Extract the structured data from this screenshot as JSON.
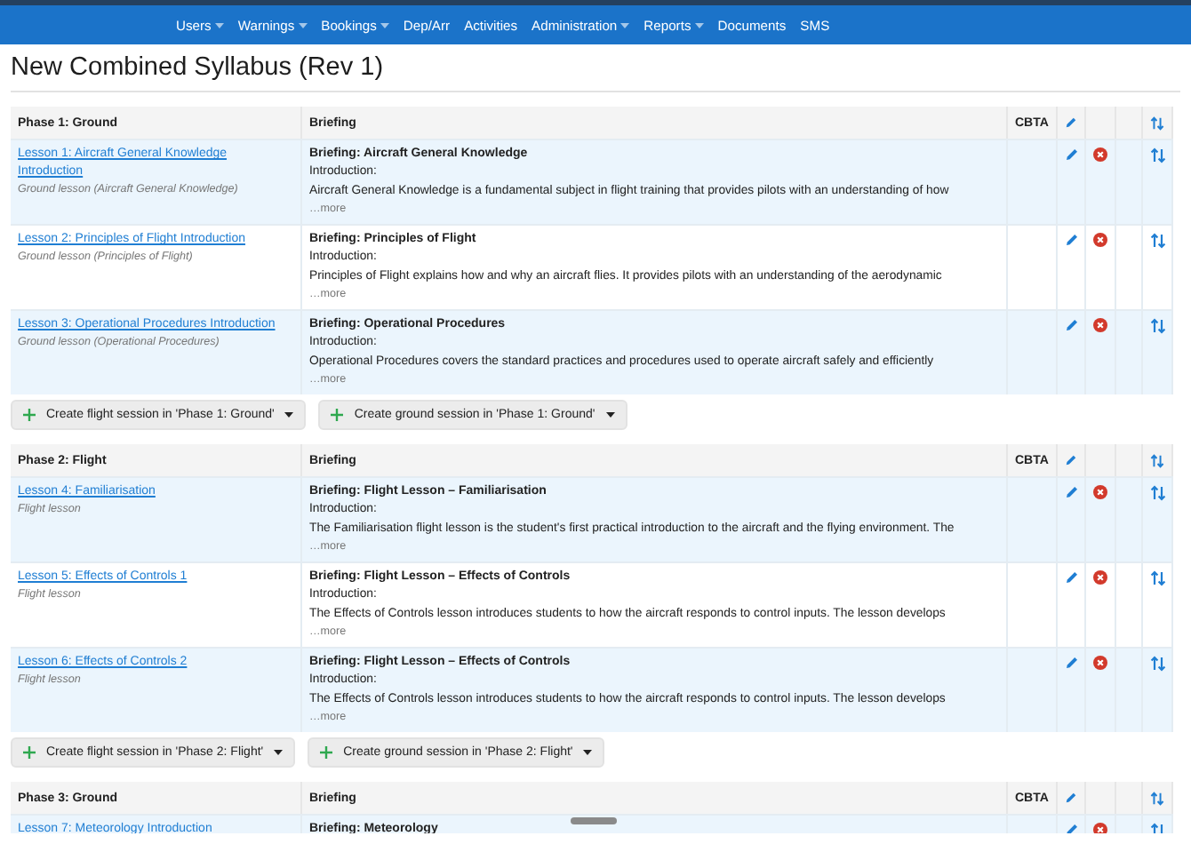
{
  "nav": [
    {
      "label": "Users",
      "dropdown": true
    },
    {
      "label": "Warnings",
      "dropdown": true
    },
    {
      "label": "Bookings",
      "dropdown": true
    },
    {
      "label": "Dep/Arr",
      "dropdown": false
    },
    {
      "label": "Activities",
      "dropdown": false
    },
    {
      "label": "Administration",
      "dropdown": true
    },
    {
      "label": "Reports",
      "dropdown": true
    },
    {
      "label": "Documents",
      "dropdown": false
    },
    {
      "label": "SMS",
      "dropdown": false
    }
  ],
  "title": "New Combined Syllabus (Rev 1)",
  "phases": [
    {
      "name": "Phase 1: Ground",
      "briefing_header": "Briefing",
      "cbta_header": "CBTA",
      "lessons": [
        {
          "title": "Lesson 1: Aircraft General Knowledge Introduction",
          "subtitle": "Ground lesson (Aircraft General Knowledge)",
          "briefing_title": "Briefing: Aircraft General Knowledge",
          "intro_label": "Introduction:",
          "text": "Aircraft General Knowledge is a fundamental subject in flight training that provides pilots with an understanding of how",
          "more": "…more"
        },
        {
          "title": "Lesson 2: Principles of Flight Introduction",
          "subtitle": "Ground lesson (Principles of Flight)",
          "briefing_title": "Briefing: Principles of Flight",
          "intro_label": "Introduction:",
          "text": "Principles of Flight explains how and why an aircraft flies. It provides pilots with an understanding of the aerodynamic",
          "more": "…more"
        },
        {
          "title": "Lesson 3: Operational Procedures Introduction",
          "subtitle": "Ground lesson (Operational Procedures)",
          "briefing_title": "Briefing: Operational Procedures",
          "intro_label": "Introduction:",
          "text": "Operational Procedures covers the standard practices and procedures used to operate aircraft safely and efficiently",
          "more": "…more"
        }
      ],
      "buttons": [
        "Create flight session in 'Phase 1: Ground'",
        "Create ground session in 'Phase 1: Ground'"
      ]
    },
    {
      "name": "Phase 2: Flight",
      "briefing_header": "Briefing",
      "cbta_header": "CBTA",
      "lessons": [
        {
          "title": "Lesson 4: Familiarisation",
          "subtitle": "Flight lesson",
          "briefing_title": "Briefing: Flight Lesson – Familiarisation",
          "intro_label": "Introduction:",
          "text": "The Familiarisation flight lesson is the student's first practical introduction to the aircraft and the flying environment. The",
          "more": "…more"
        },
        {
          "title": "Lesson 5: Effects of Controls 1",
          "subtitle": "Flight lesson",
          "briefing_title": "Briefing: Flight Lesson – Effects of Controls",
          "intro_label": "Introduction:",
          "text": "The Effects of Controls lesson introduces students to how the aircraft responds to control inputs. The lesson develops",
          "more": "…more"
        },
        {
          "title": "Lesson 6: Effects of Controls 2",
          "subtitle": "Flight lesson",
          "briefing_title": "Briefing: Flight Lesson – Effects of Controls",
          "intro_label": "Introduction:",
          "text": "The Effects of Controls lesson introduces students to how the aircraft responds to control inputs. The lesson develops",
          "more": "…more"
        }
      ],
      "buttons": [
        "Create flight session in 'Phase 2: Flight'",
        "Create ground session in 'Phase 2: Flight'"
      ]
    },
    {
      "name": "Phase 3: Ground",
      "briefing_header": "Briefing",
      "cbta_header": "CBTA",
      "lessons": [
        {
          "title": "Lesson 7: Meteorology Introduction",
          "briefing_title": "Briefing: Meteorology"
        }
      ]
    }
  ]
}
